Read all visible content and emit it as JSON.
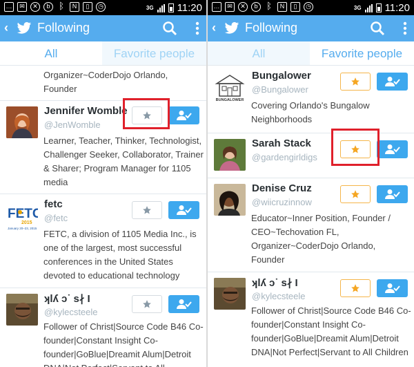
{
  "status_bar": {
    "time": "11:20",
    "network": "3G",
    "icons": [
      "message-icon",
      "email-icon",
      "mute-icon",
      "beats-icon",
      "bluetooth-icon",
      "nfc-icon",
      "vibrate-icon",
      "alarm-icon"
    ]
  },
  "left": {
    "title": "Following",
    "tabs": [
      {
        "label": "All",
        "active": true
      },
      {
        "label": "Favorite people",
        "active": false
      }
    ],
    "partial_bio_top": "Organizer~CoderDojo Orlando,\nFounder",
    "users": [
      {
        "name": "Jennifer Womble",
        "handle": "@JenWomble",
        "bio": "Learner, Teacher, Thinker, Technologist, Challenger Seeker, Collaborator, Trainer & Sharer; Program Manager for 1105 media",
        "favorited": false,
        "highlighted": true
      },
      {
        "name": "fetc",
        "handle": "@fetc",
        "bio": "FETC, a division of 1105 Media Inc., is one of the largest, most successful conferences in the United States devoted to educational technology",
        "favorited": false,
        "highlighted": false,
        "logo": {
          "letters": "FETC",
          "year": "2015",
          "dates": "January 20–23, 2015"
        }
      },
      {
        "name": "ʞlʎ ɔ˙ s∤ I",
        "handle": "@kylecsteele",
        "bio": "Follower of Christ|Source Code B46 Co-founder|Constant Insight Co-founder|GoBlue|Dreamit Alum|Detroit DNA|Not Perfect|Servant to All",
        "favorited": false,
        "highlighted": false
      }
    ]
  },
  "right": {
    "title": "Following",
    "tabs": [
      {
        "label": "All",
        "active": false
      },
      {
        "label": "Favorite people",
        "active": true
      }
    ],
    "users": [
      {
        "name": "Bungalower",
        "handle": "@Bungalower",
        "bio": "Covering Orlando's Bungalow Neighborhoods",
        "favorited": true,
        "highlighted": false,
        "logo": {
          "caption": "BUNGALOWER"
        }
      },
      {
        "name": "Sarah Stack",
        "handle": "@gardengirldigs",
        "bio": "",
        "favorited": true,
        "highlighted": true
      },
      {
        "name": "Denise Cruz",
        "handle": "@wiicruzinnow",
        "bio": "Educator~Inner Position, Founder / CEO~Techovation FL, Organizer~CoderDojo Orlando, Founder",
        "favorited": true,
        "highlighted": false
      },
      {
        "name": "ʞlʎ ɔ˙ s∤ I",
        "handle": "@kylecsteele",
        "bio": "Follower of Christ|Source Code B46 Co-founder|Constant Insight Co-founder|GoBlue|Dreamit Alum|Detroit DNA|Not Perfect|Servant to All Children",
        "favorited": true,
        "highlighted": false
      }
    ]
  },
  "colors": {
    "twitter_blue": "#55acee",
    "follow_button": "#3da8ee",
    "favorite_star": "#f5a623",
    "unfavorite_star": "#8899a6",
    "highlight_box": "#e0202b"
  }
}
